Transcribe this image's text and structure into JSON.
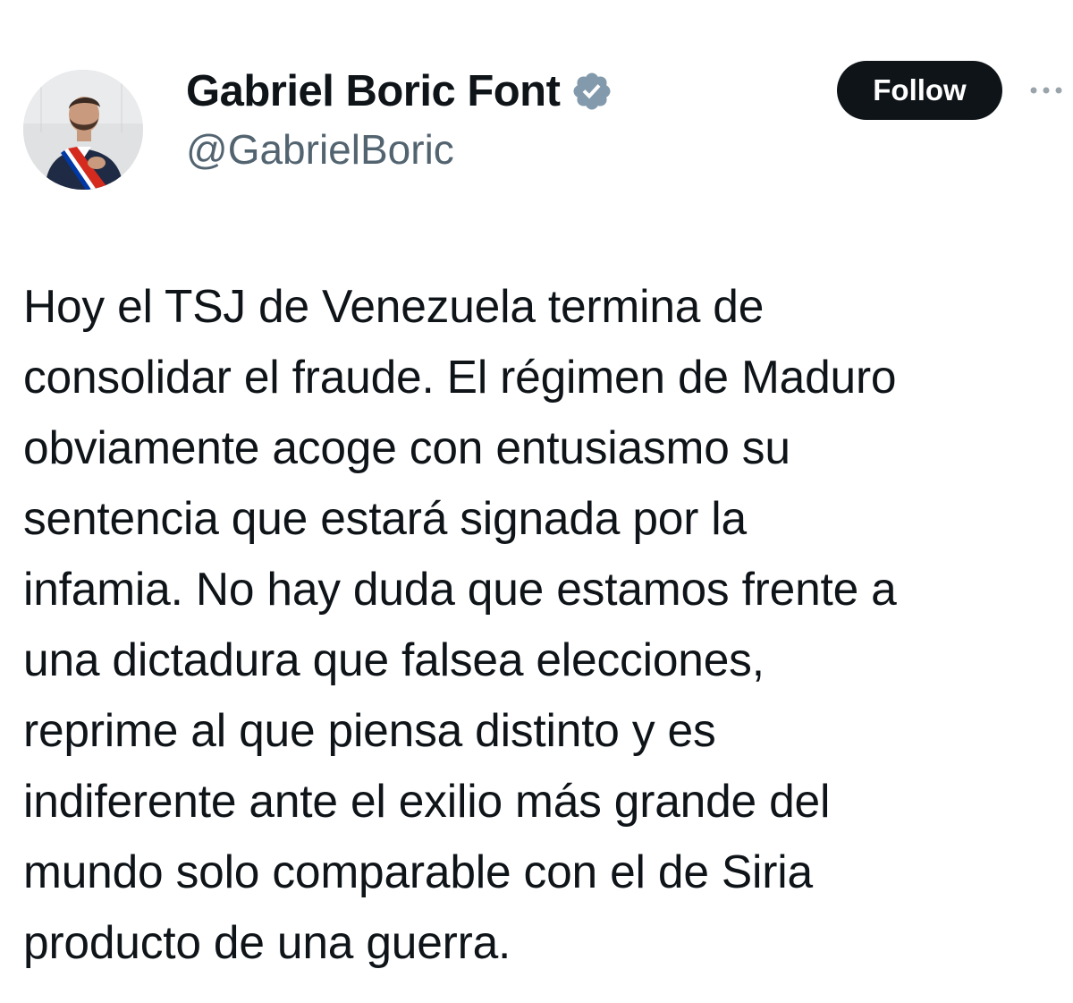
{
  "author": {
    "display_name": "Gabriel Boric Font",
    "handle": "@GabrielBoric",
    "verified_icon": "verified-badge-icon",
    "avatar_icon": "profile-photo"
  },
  "actions": {
    "follow_label": "Follow",
    "more_icon": "more-options-icon"
  },
  "tweet": {
    "text": "Hoy el TSJ de Venezuela termina de\nconsolidar el fraude. El régimen de Maduro\nobviamente acoge con entusiasmo su\nsentencia que estará signada por la\ninfamia. No hay duda que estamos frente a\nuna dictadura que falsea elecciones,\nreprime al que piensa distinto y es\nindiferente ante el exilio más grande del\nmundo solo comparable con el de Siria\nproducto de una guerra."
  },
  "colors": {
    "text_primary": "#0f1419",
    "text_secondary": "#536471",
    "follow_bg": "#0f1419",
    "follow_text": "#ffffff",
    "verified": "#829aab"
  }
}
